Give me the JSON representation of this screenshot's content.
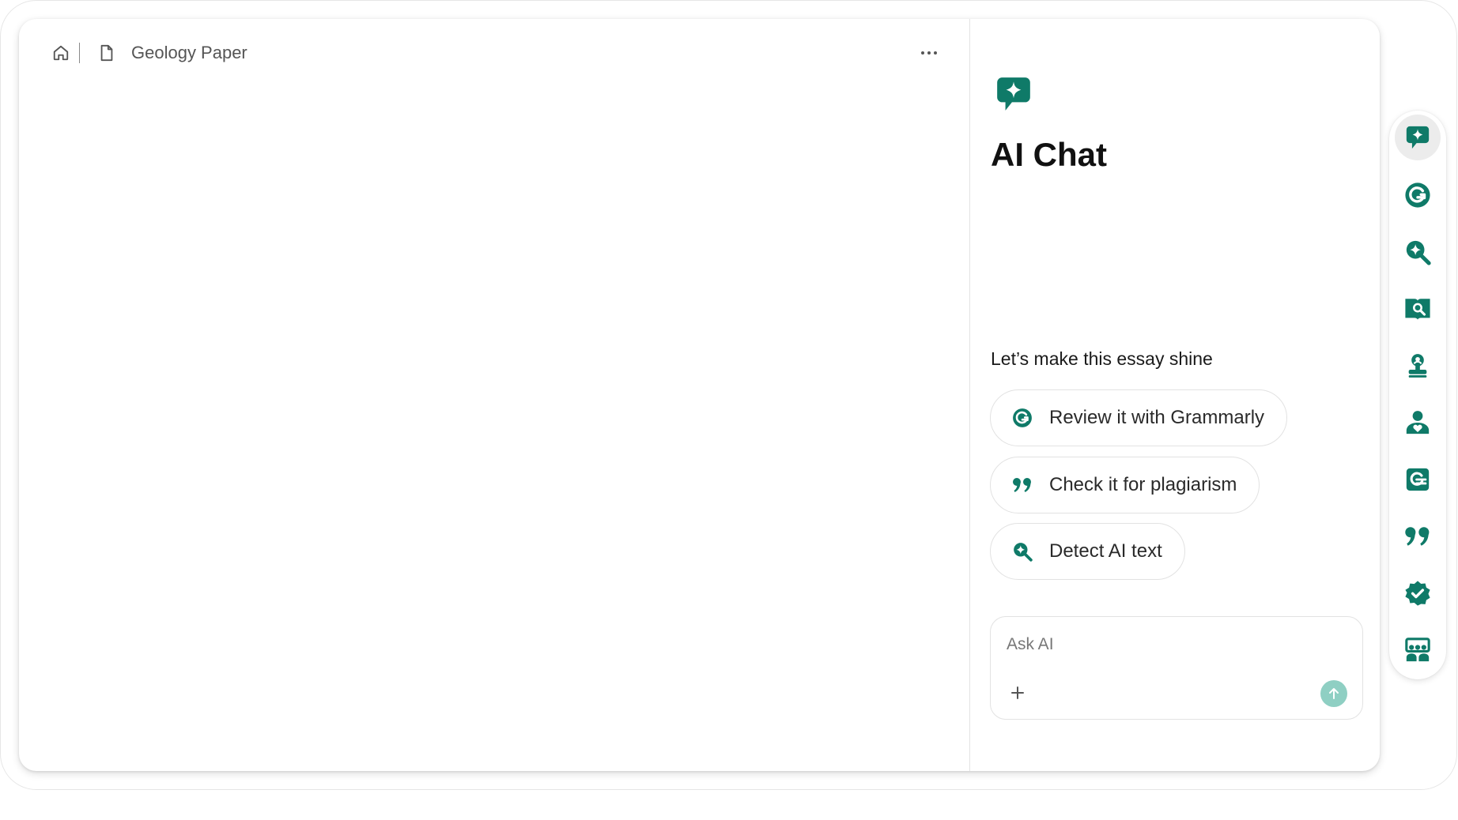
{
  "theme": {
    "accent": "#0f7a68",
    "send_button_disabled": "#8fcfc3"
  },
  "document": {
    "breadcrumb_home_icon": "home-icon",
    "breadcrumb_doc_icon": "document-icon",
    "title": "Geology Paper",
    "more_menu_icon": "more-horizontal-icon"
  },
  "chat": {
    "logo_icon": "ai-chat-sparkle-icon",
    "title": "AI Chat",
    "prompt_heading": "Let’s make this essay shine",
    "suggestions": [
      {
        "label": "Review it with Grammarly",
        "icon": "grammarly-icon"
      },
      {
        "label": "Check it for plagiarism",
        "icon": "quote-icon"
      },
      {
        "label": "Detect AI text",
        "icon": "ai-detector-search-icon"
      }
    ],
    "input": {
      "placeholder": "Ask AI",
      "value": "",
      "attach_icon": "plus-icon",
      "send_icon": "arrow-up-icon"
    }
  },
  "rail": {
    "items": [
      {
        "name": "ai-chat",
        "icon": "ai-chat-sparkle-icon",
        "active": true
      },
      {
        "name": "grammarly",
        "icon": "grammarly-icon",
        "active": false
      },
      {
        "name": "ai-detector",
        "icon": "ai-detector-search-icon",
        "active": false
      },
      {
        "name": "plagiarism-checker",
        "icon": "book-search-icon",
        "active": false
      },
      {
        "name": "reader-reactions",
        "icon": "stamp-user-icon",
        "active": false
      },
      {
        "name": "expert-review",
        "icon": "user-heart-icon",
        "active": false
      },
      {
        "name": "grade-predictor",
        "icon": "grade-card-icon",
        "active": false
      },
      {
        "name": "citations",
        "icon": "quote-icon",
        "active": false
      },
      {
        "name": "authorship",
        "icon": "verified-badge-icon",
        "active": false
      },
      {
        "name": "audience",
        "icon": "presentation-users-icon",
        "active": false
      }
    ]
  }
}
